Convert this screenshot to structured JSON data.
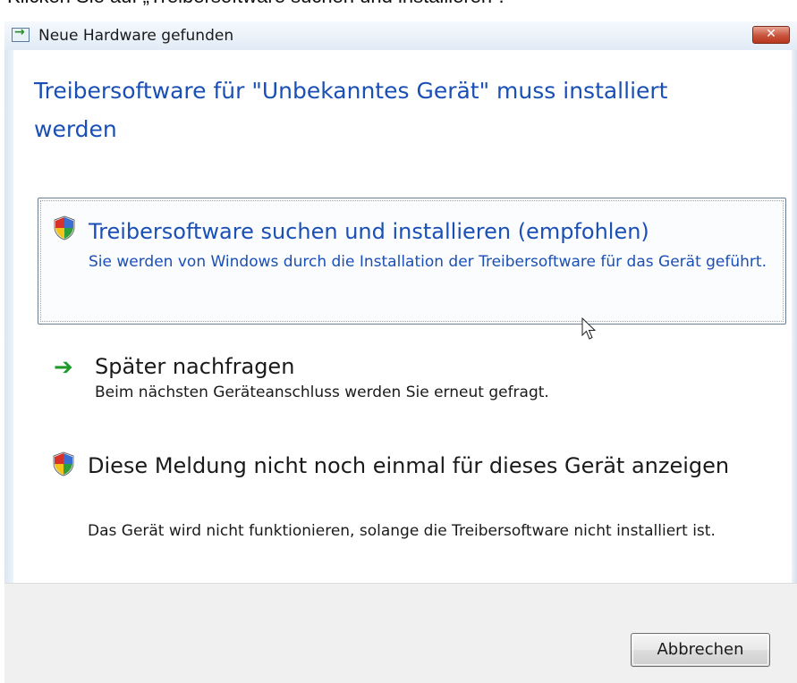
{
  "caption": {
    "text": "Klicken Sie auf „Treibersoftware suchen und installieren“."
  },
  "window": {
    "title": "Neue Hardware gefunden",
    "close_symbol": "✕"
  },
  "heading": "Treibersoftware für \"Unbekanntes Gerät\" muss installiert werden",
  "options": [
    {
      "icon": "shield-icon",
      "title": "Treibersoftware suchen und installieren (empfohlen)",
      "description": "Sie werden von Windows durch die Installation der Treibersoftware für das Gerät geführt.",
      "selected": true
    },
    {
      "icon": "green-arrow-icon",
      "arrow_glyph": "➔",
      "title": "Später nachfragen",
      "description": "Beim nächsten Geräteanschluss werden Sie erneut gefragt.",
      "selected": false
    },
    {
      "icon": "shield-icon",
      "title": "Diese Meldung nicht noch einmal für dieses Gerät anzeigen",
      "description": "Das Gerät wird nicht funktionieren, solange die Treibersoftware nicht installiert ist.",
      "selected": false
    }
  ],
  "footer": {
    "cancel_label": "Abbrechen"
  },
  "colors": {
    "link_blue": "#1a4fb5",
    "arrow_green": "#1f9a2a"
  }
}
